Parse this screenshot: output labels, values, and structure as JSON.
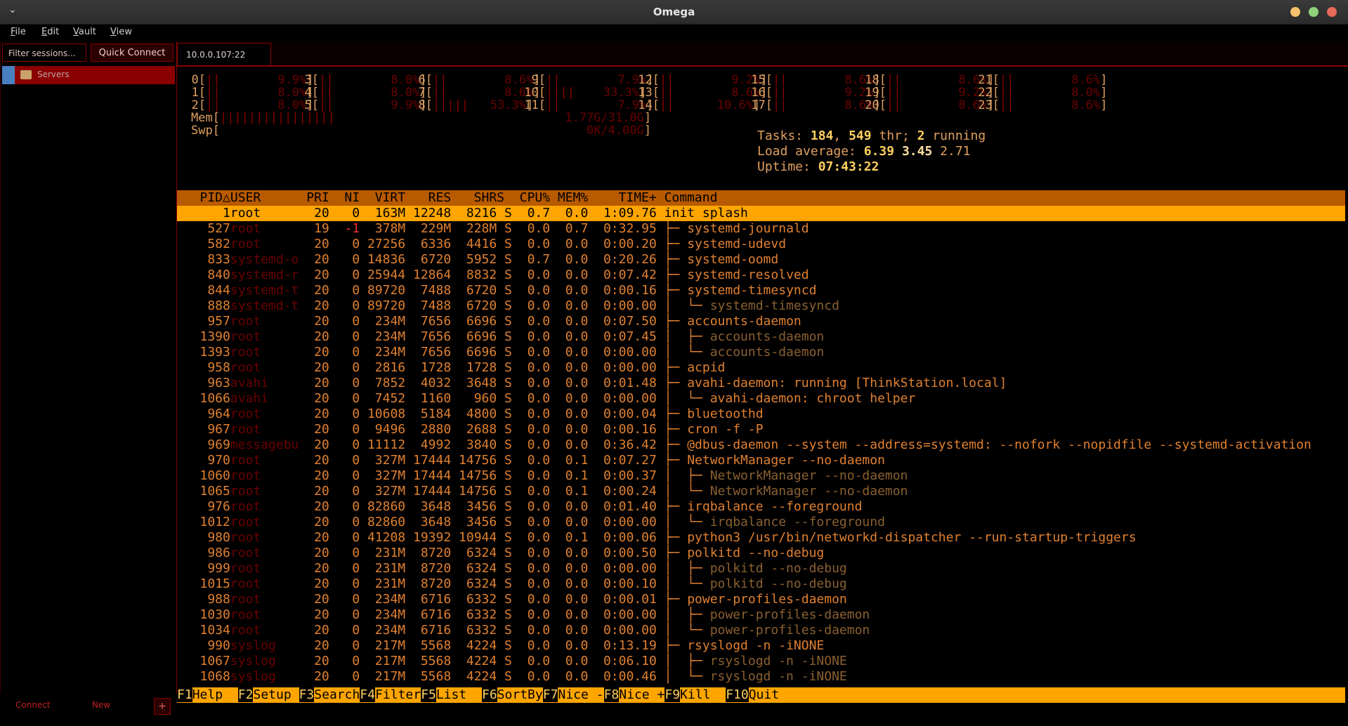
{
  "window": {
    "title": "Omega"
  },
  "menu": [
    "File",
    "Edit",
    "Vault",
    "View"
  ],
  "sidebar": {
    "filter_placeholder": "Filter sessions...",
    "quick_connect": "Quick Connect",
    "tree": [
      {
        "label": "Servers",
        "icon": "folder-icon"
      }
    ],
    "footer": {
      "connect": "Connect",
      "new": "New",
      "plus": "+"
    }
  },
  "tabs": [
    {
      "label": "10.0.0.107:22"
    }
  ],
  "htop": {
    "cpus": [
      {
        "id": "0",
        "pct": "9.9%"
      },
      {
        "id": "1",
        "pct": "8.0%"
      },
      {
        "id": "2",
        "pct": "8.0%"
      },
      {
        "id": "3",
        "pct": "8.0%"
      },
      {
        "id": "4",
        "pct": "8.0%"
      },
      {
        "id": "5",
        "pct": "9.9%"
      },
      {
        "id": "6",
        "pct": "8.6%"
      },
      {
        "id": "7",
        "pct": "8.6%"
      },
      {
        "id": "8",
        "pct": "53.3%"
      },
      {
        "id": "9",
        "pct": "7.9%"
      },
      {
        "id": "10",
        "pct": "33.3%"
      },
      {
        "id": "11",
        "pct": "7.9%"
      },
      {
        "id": "12",
        "pct": "9.2%"
      },
      {
        "id": "13",
        "pct": "8.6%"
      },
      {
        "id": "14",
        "pct": "10.6%"
      },
      {
        "id": "15",
        "pct": "8.6%"
      },
      {
        "id": "16",
        "pct": "9.2%"
      },
      {
        "id": "17",
        "pct": "8.6%"
      },
      {
        "id": "18",
        "pct": "8.6%"
      },
      {
        "id": "19",
        "pct": "9.2%"
      },
      {
        "id": "20",
        "pct": "8.6%"
      },
      {
        "id": "21",
        "pct": "8.6%"
      },
      {
        "id": "22",
        "pct": "8.0%"
      },
      {
        "id": "23",
        "pct": "8.6%"
      }
    ],
    "mem": {
      "label": "Mem",
      "value": "1.77G/31.0G"
    },
    "swp": {
      "label": "Swp",
      "value": "0K/4.00G"
    },
    "tasks": {
      "prefix": "Tasks:",
      "count": "184",
      "thr": "549",
      "thr_label": "thr;",
      "running": "2",
      "running_label": "running"
    },
    "load": {
      "prefix": "Load average:",
      "a": "6.39",
      "b": "3.45",
      "c": "2.71"
    },
    "uptime": {
      "prefix": "Uptime:",
      "value": "07:43:22"
    },
    "columns": [
      "PID△",
      "USER",
      "PRI",
      "NI",
      "VIRT",
      "RES",
      "SHR",
      "S",
      "CPU%",
      "MEM%",
      "TIME+",
      "Command"
    ],
    "processes": [
      {
        "pid": "1",
        "user": "root",
        "pri": "20",
        "ni": "0",
        "virt": "163M",
        "res": "12248",
        "shr": "8216",
        "s": "S",
        "cpu": "0.7",
        "mem": "0.0",
        "time": "1:09.76",
        "tree": "",
        "cmd": "init splash",
        "thread": false
      },
      {
        "pid": "527",
        "user": "root",
        "pri": "19",
        "ni": "-1",
        "virt": "378M",
        "res": "229M",
        "shr": "228M",
        "s": "S",
        "cpu": "0.0",
        "mem": "0.7",
        "time": "0:32.95",
        "tree": "├─ ",
        "cmd": "systemd-journald",
        "thread": false
      },
      {
        "pid": "582",
        "user": "root",
        "pri": "20",
        "ni": "0",
        "virt": "27256",
        "res": "6336",
        "shr": "4416",
        "s": "S",
        "cpu": "0.0",
        "mem": "0.0",
        "time": "0:00.20",
        "tree": "├─ ",
        "cmd": "systemd-udevd",
        "thread": false
      },
      {
        "pid": "833",
        "user": "systemd-o",
        "pri": "20",
        "ni": "0",
        "virt": "14836",
        "res": "6720",
        "shr": "5952",
        "s": "S",
        "cpu": "0.7",
        "mem": "0.0",
        "time": "0:20.26",
        "tree": "├─ ",
        "cmd": "systemd-oomd",
        "thread": false
      },
      {
        "pid": "840",
        "user": "systemd-r",
        "pri": "20",
        "ni": "0",
        "virt": "25944",
        "res": "12864",
        "shr": "8832",
        "s": "S",
        "cpu": "0.0",
        "mem": "0.0",
        "time": "0:07.42",
        "tree": "├─ ",
        "cmd": "systemd-resolved",
        "thread": false
      },
      {
        "pid": "844",
        "user": "systemd-t",
        "pri": "20",
        "ni": "0",
        "virt": "89720",
        "res": "7488",
        "shr": "6720",
        "s": "S",
        "cpu": "0.0",
        "mem": "0.0",
        "time": "0:00.16",
        "tree": "├─ ",
        "cmd": "systemd-timesyncd",
        "thread": false
      },
      {
        "pid": "888",
        "user": "systemd-t",
        "pri": "20",
        "ni": "0",
        "virt": "89720",
        "res": "7488",
        "shr": "6720",
        "s": "S",
        "cpu": "0.0",
        "mem": "0.0",
        "time": "0:00.00",
        "tree": "│  └─ ",
        "cmd": "systemd-timesyncd",
        "thread": true
      },
      {
        "pid": "957",
        "user": "root",
        "pri": "20",
        "ni": "0",
        "virt": "234M",
        "res": "7656",
        "shr": "6696",
        "s": "S",
        "cpu": "0.0",
        "mem": "0.0",
        "time": "0:07.50",
        "tree": "├─ ",
        "cmd": "accounts-daemon",
        "thread": false
      },
      {
        "pid": "1390",
        "user": "root",
        "pri": "20",
        "ni": "0",
        "virt": "234M",
        "res": "7656",
        "shr": "6696",
        "s": "S",
        "cpu": "0.0",
        "mem": "0.0",
        "time": "0:07.45",
        "tree": "│  ├─ ",
        "cmd": "accounts-daemon",
        "thread": true
      },
      {
        "pid": "1393",
        "user": "root",
        "pri": "20",
        "ni": "0",
        "virt": "234M",
        "res": "7656",
        "shr": "6696",
        "s": "S",
        "cpu": "0.0",
        "mem": "0.0",
        "time": "0:00.00",
        "tree": "│  └─ ",
        "cmd": "accounts-daemon",
        "thread": true
      },
      {
        "pid": "958",
        "user": "root",
        "pri": "20",
        "ni": "0",
        "virt": "2816",
        "res": "1728",
        "shr": "1728",
        "s": "S",
        "cpu": "0.0",
        "mem": "0.0",
        "time": "0:00.00",
        "tree": "├─ ",
        "cmd": "acpid",
        "thread": false
      },
      {
        "pid": "963",
        "user": "avahi",
        "pri": "20",
        "ni": "0",
        "virt": "7852",
        "res": "4032",
        "shr": "3648",
        "s": "S",
        "cpu": "0.0",
        "mem": "0.0",
        "time": "0:01.48",
        "tree": "├─ ",
        "cmd": "avahi-daemon: running [ThinkStation.local]",
        "thread": false
      },
      {
        "pid": "1066",
        "user": "avahi",
        "pri": "20",
        "ni": "0",
        "virt": "7452",
        "res": "1160",
        "shr": "960",
        "s": "S",
        "cpu": "0.0",
        "mem": "0.0",
        "time": "0:00.00",
        "tree": "│  └─ ",
        "cmd": "avahi-daemon: chroot helper",
        "thread": false
      },
      {
        "pid": "964",
        "user": "root",
        "pri": "20",
        "ni": "0",
        "virt": "10608",
        "res": "5184",
        "shr": "4800",
        "s": "S",
        "cpu": "0.0",
        "mem": "0.0",
        "time": "0:00.04",
        "tree": "├─ ",
        "cmd": "bluetoothd",
        "thread": false
      },
      {
        "pid": "967",
        "user": "root",
        "pri": "20",
        "ni": "0",
        "virt": "9496",
        "res": "2880",
        "shr": "2688",
        "s": "S",
        "cpu": "0.0",
        "mem": "0.0",
        "time": "0:00.16",
        "tree": "├─ ",
        "cmd": "cron -f -P",
        "thread": false
      },
      {
        "pid": "969",
        "user": "messagebu",
        "pri": "20",
        "ni": "0",
        "virt": "11112",
        "res": "4992",
        "shr": "3840",
        "s": "S",
        "cpu": "0.0",
        "mem": "0.0",
        "time": "0:36.42",
        "tree": "├─ ",
        "cmd": "@dbus-daemon --system --address=systemd: --nofork --nopidfile --systemd-activation",
        "thread": false
      },
      {
        "pid": "970",
        "user": "root",
        "pri": "20",
        "ni": "0",
        "virt": "327M",
        "res": "17444",
        "shr": "14756",
        "s": "S",
        "cpu": "0.0",
        "mem": "0.1",
        "time": "0:07.27",
        "tree": "├─ ",
        "cmd": "NetworkManager --no-daemon",
        "thread": false
      },
      {
        "pid": "1060",
        "user": "root",
        "pri": "20",
        "ni": "0",
        "virt": "327M",
        "res": "17444",
        "shr": "14756",
        "s": "S",
        "cpu": "0.0",
        "mem": "0.1",
        "time": "0:00.37",
        "tree": "│  ├─ ",
        "cmd": "NetworkManager --no-daemon",
        "thread": true
      },
      {
        "pid": "1065",
        "user": "root",
        "pri": "20",
        "ni": "0",
        "virt": "327M",
        "res": "17444",
        "shr": "14756",
        "s": "S",
        "cpu": "0.0",
        "mem": "0.1",
        "time": "0:00.24",
        "tree": "│  └─ ",
        "cmd": "NetworkManager --no-daemon",
        "thread": true
      },
      {
        "pid": "976",
        "user": "root",
        "pri": "20",
        "ni": "0",
        "virt": "82860",
        "res": "3648",
        "shr": "3456",
        "s": "S",
        "cpu": "0.0",
        "mem": "0.0",
        "time": "0:01.40",
        "tree": "├─ ",
        "cmd": "irqbalance --foreground",
        "thread": false
      },
      {
        "pid": "1012",
        "user": "root",
        "pri": "20",
        "ni": "0",
        "virt": "82860",
        "res": "3648",
        "shr": "3456",
        "s": "S",
        "cpu": "0.0",
        "mem": "0.0",
        "time": "0:00.00",
        "tree": "│  └─ ",
        "cmd": "irqbalance --foreground",
        "thread": true
      },
      {
        "pid": "980",
        "user": "root",
        "pri": "20",
        "ni": "0",
        "virt": "41208",
        "res": "19392",
        "shr": "10944",
        "s": "S",
        "cpu": "0.0",
        "mem": "0.1",
        "time": "0:00.06",
        "tree": "├─ ",
        "cmd": "python3 /usr/bin/networkd-dispatcher --run-startup-triggers",
        "thread": false
      },
      {
        "pid": "986",
        "user": "root",
        "pri": "20",
        "ni": "0",
        "virt": "231M",
        "res": "8720",
        "shr": "6324",
        "s": "S",
        "cpu": "0.0",
        "mem": "0.0",
        "time": "0:00.50",
        "tree": "├─ ",
        "cmd": "polkitd --no-debug",
        "thread": false
      },
      {
        "pid": "999",
        "user": "root",
        "pri": "20",
        "ni": "0",
        "virt": "231M",
        "res": "8720",
        "shr": "6324",
        "s": "S",
        "cpu": "0.0",
        "mem": "0.0",
        "time": "0:00.00",
        "tree": "│  ├─ ",
        "cmd": "polkitd --no-debug",
        "thread": true
      },
      {
        "pid": "1015",
        "user": "root",
        "pri": "20",
        "ni": "0",
        "virt": "231M",
        "res": "8720",
        "shr": "6324",
        "s": "S",
        "cpu": "0.0",
        "mem": "0.0",
        "time": "0:00.10",
        "tree": "│  └─ ",
        "cmd": "polkitd --no-debug",
        "thread": true
      },
      {
        "pid": "988",
        "user": "root",
        "pri": "20",
        "ni": "0",
        "virt": "234M",
        "res": "6716",
        "shr": "6332",
        "s": "S",
        "cpu": "0.0",
        "mem": "0.0",
        "time": "0:00.01",
        "tree": "├─ ",
        "cmd": "power-profiles-daemon",
        "thread": false
      },
      {
        "pid": "1030",
        "user": "root",
        "pri": "20",
        "ni": "0",
        "virt": "234M",
        "res": "6716",
        "shr": "6332",
        "s": "S",
        "cpu": "0.0",
        "mem": "0.0",
        "time": "0:00.00",
        "tree": "│  ├─ ",
        "cmd": "power-profiles-daemon",
        "thread": true
      },
      {
        "pid": "1034",
        "user": "root",
        "pri": "20",
        "ni": "0",
        "virt": "234M",
        "res": "6716",
        "shr": "6332",
        "s": "S",
        "cpu": "0.0",
        "mem": "0.0",
        "time": "0:00.00",
        "tree": "│  └─ ",
        "cmd": "power-profiles-daemon",
        "thread": true
      },
      {
        "pid": "990",
        "user": "syslog",
        "pri": "20",
        "ni": "0",
        "virt": "217M",
        "res": "5568",
        "shr": "4224",
        "s": "S",
        "cpu": "0.0",
        "mem": "0.0",
        "time": "0:13.19",
        "tree": "├─ ",
        "cmd": "rsyslogd -n -iNONE",
        "thread": false
      },
      {
        "pid": "1067",
        "user": "syslog",
        "pri": "20",
        "ni": "0",
        "virt": "217M",
        "res": "5568",
        "shr": "4224",
        "s": "S",
        "cpu": "0.0",
        "mem": "0.0",
        "time": "0:06.10",
        "tree": "│  ├─ ",
        "cmd": "rsyslogd -n -iNONE",
        "thread": true
      },
      {
        "pid": "1068",
        "user": "syslog",
        "pri": "20",
        "ni": "0",
        "virt": "217M",
        "res": "5568",
        "shr": "4224",
        "s": "S",
        "cpu": "0.0",
        "mem": "0.0",
        "time": "0:00.46",
        "tree": "│  └─ ",
        "cmd": "rsyslogd -n -iNONE",
        "thread": true
      }
    ],
    "fkeys": [
      {
        "key": "F1",
        "label": "Help  "
      },
      {
        "key": "F2",
        "label": "Setup "
      },
      {
        "key": "F3",
        "label": "Search"
      },
      {
        "key": "F4",
        "label": "Filter"
      },
      {
        "key": "F5",
        "label": "List  "
      },
      {
        "key": "F6",
        "label": "SortBy"
      },
      {
        "key": "F7",
        "label": "Nice -"
      },
      {
        "key": "F8",
        "label": "Nice +"
      },
      {
        "key": "F9",
        "label": "Kill  "
      },
      {
        "key": "F10",
        "label": "Quit"
      }
    ]
  },
  "colors": {
    "accent": "#8a0000",
    "highlight": "#ffa500",
    "header": "#b85a00",
    "text": "#e08030"
  }
}
